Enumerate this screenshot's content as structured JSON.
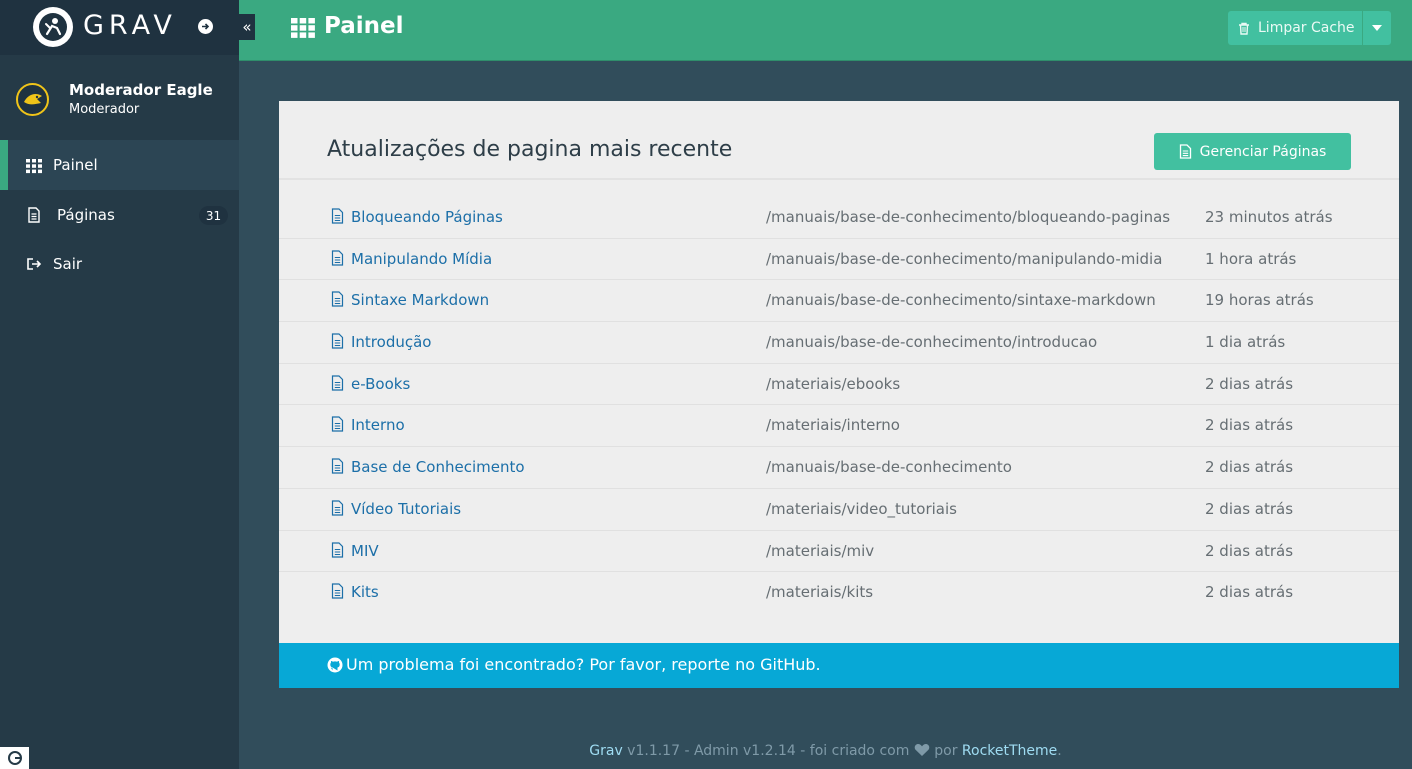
{
  "sidebar": {
    "logo_text": "GRAV",
    "user": {
      "name": "Moderador Eagle",
      "role": "Moderador"
    },
    "items": [
      {
        "label": "Painel",
        "icon": "grid-icon",
        "active": true
      },
      {
        "label": "Páginas",
        "icon": "file-icon",
        "badge": "31"
      },
      {
        "label": "Sair",
        "icon": "sign-out-icon"
      }
    ]
  },
  "header": {
    "title": "Painel",
    "clear_cache_label": "Limpar Cache"
  },
  "card": {
    "title": "Atualizações de pagina mais recente",
    "manage_pages_label": "Gerenciar Páginas",
    "rows": [
      {
        "title": "Bloqueando Páginas",
        "route": "/manuais/base-de-conhecimento/bloqueando-paginas",
        "time": "23 minutos atrás"
      },
      {
        "title": "Manipulando Mídia",
        "route": "/manuais/base-de-conhecimento/manipulando-midia",
        "time": "1 hora atrás"
      },
      {
        "title": "Sintaxe Markdown",
        "route": "/manuais/base-de-conhecimento/sintaxe-markdown",
        "time": "19 horas atrás"
      },
      {
        "title": "Introdução",
        "route": "/manuais/base-de-conhecimento/introducao",
        "time": "1 dia atrás"
      },
      {
        "title": "e-Books",
        "route": "/materiais/ebooks",
        "time": "2 dias atrás"
      },
      {
        "title": "Interno",
        "route": "/materiais/interno",
        "time": "2 dias atrás"
      },
      {
        "title": "Base de Conhecimento",
        "route": "/manuais/base-de-conhecimento",
        "time": "2 dias atrás"
      },
      {
        "title": "Vídeo Tutoriais",
        "route": "/materiais/video_tutoriais",
        "time": "2 dias atrás"
      },
      {
        "title": "MIV",
        "route": "/materiais/miv",
        "time": "2 dias atrás"
      },
      {
        "title": "Kits",
        "route": "/materiais/kits",
        "time": "2 dias atrás"
      }
    ]
  },
  "notice": {
    "text": "Um problema foi encontrado? Por favor, reporte no GitHub."
  },
  "footer": {
    "grav_link": "Grav",
    "version_text": " v1.1.17 - Admin v1.2.14 - foi criado com ",
    "by_text": " por ",
    "rockettheme_link": "RocketTheme",
    "end": "."
  },
  "colors": {
    "accent": "#3aa981",
    "button": "#42c0a0",
    "sidebar": "#253a47",
    "content_bg": "#314d5b",
    "link": "#1c6fa8",
    "notice": "#07a8d6"
  }
}
